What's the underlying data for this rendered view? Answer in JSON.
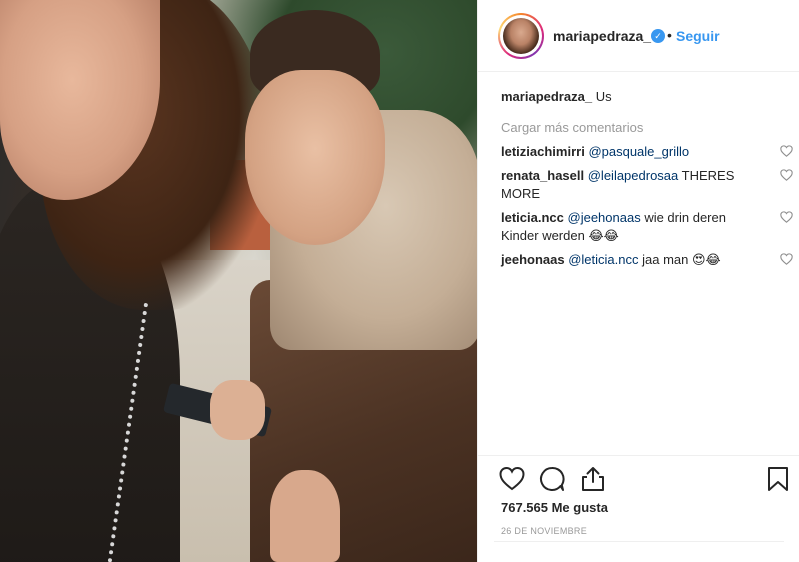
{
  "post": {
    "photo_alt": "",
    "header": {
      "username": "mariapedraza_",
      "verified_icon": "verified-badge-icon",
      "separator": "•",
      "follow_label": "Seguir"
    },
    "caption": {
      "username": "mariapedraza_",
      "text": "Us"
    },
    "load_more": "Cargar más comentarios",
    "comments": [
      {
        "username": "letiziachimirri",
        "mention": "@pasquale_grillo",
        "text": ""
      },
      {
        "username": "renata_hasell",
        "mention": "@leilapedrosaa",
        "text": " THERES MORE"
      },
      {
        "username": "leticia.ncc",
        "mention": "@jeehonaas",
        "text": " wie drin deren Kinder werden 😂😂"
      },
      {
        "username": "jeehonaas",
        "mention": "@leticia.ncc",
        "text": " jaa man 😍😂"
      }
    ],
    "actions": {
      "like_icon": "heart-icon",
      "comment_icon": "comment-icon",
      "share_icon": "share-icon",
      "save_icon": "bookmark-icon"
    },
    "likes": "767.565 Me gusta",
    "date": "26 DE NOVIEMBRE"
  },
  "colors": {
    "link": "#3897f0",
    "mention": "#003569",
    "muted": "#999999",
    "text": "#262626"
  }
}
